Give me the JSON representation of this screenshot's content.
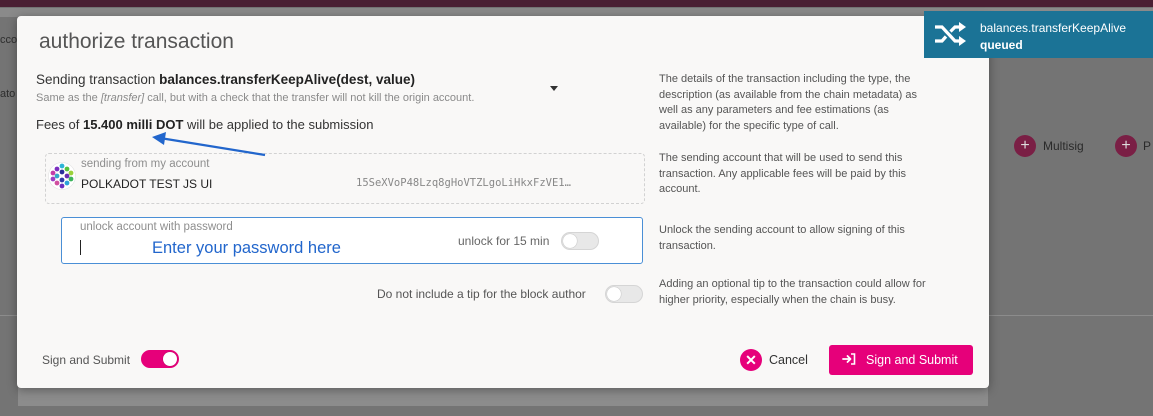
{
  "background": {
    "fragment_account": "ccou",
    "fragment_ato": "ato",
    "multisig_label": "Multisig",
    "proxy_label": "P"
  },
  "modal": {
    "title": "authorize transaction",
    "transaction": {
      "prefix": "Sending transaction",
      "call": "balances.transferKeepAlive(dest, value)",
      "description_before": "Same as the",
      "description_link": "[transfer]",
      "description_after": "call, but with a check that the transfer will not kill the origin account."
    },
    "fees": {
      "prefix": "Fees of",
      "amount": "15.400 milli DOT",
      "suffix": "will be applied to the submission"
    },
    "account": {
      "label": "sending from my account",
      "name": "POLKADOT TEST JS UI",
      "address": "15SeXVoP48Lzq8gHoVTZLgoLiHkxFzVE1…"
    },
    "password": {
      "label": "unlock account with password",
      "annotation": "Enter your password here",
      "unlock_label": "unlock for 15 min",
      "unlock_enabled": false
    },
    "tip": {
      "label": "Do not include a tip for the block author",
      "enabled": false
    },
    "sign_toggle": {
      "label": "Sign and Submit",
      "enabled": true
    },
    "cancel_label": "Cancel",
    "submit_label": "Sign and Submit",
    "help": {
      "transaction": "The details of the transaction including the type, the description (as available from the chain metadata) as well as any parameters and fee estimations (as available) for the specific type of call.",
      "account": "The sending account that will be used to send this transaction. Any applicable fees will be paid by this account.",
      "unlock": "Unlock the sending account to allow signing of this transaction.",
      "tip": "Adding an optional tip to the transaction could allow for higher priority, especially when the chain is busy."
    }
  },
  "toast": {
    "title": "balances.transferKeepAlive",
    "status": "queued",
    "icon": "shuffle-icon"
  },
  "colors": {
    "accent": "#e6007a",
    "toast": "#1b7396",
    "annotation": "#2266cc"
  }
}
